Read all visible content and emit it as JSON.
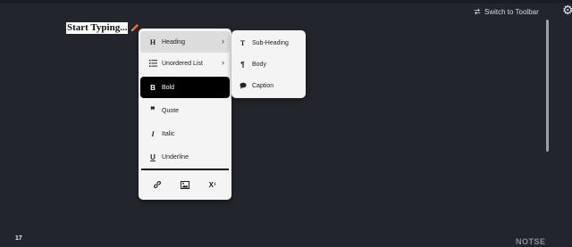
{
  "header": {
    "switch_toolbar_label": "Switch to Toolbar"
  },
  "editor": {
    "title": "Start Typing..."
  },
  "menu": {
    "items": [
      {
        "label": "Heading",
        "icon": "H",
        "has_submenu": true
      },
      {
        "label": "Unordered List",
        "icon": "list",
        "has_submenu": true
      },
      {
        "label": "Bold",
        "icon": "B"
      },
      {
        "label": "Quote",
        "icon": "quote"
      },
      {
        "label": "Italic",
        "icon": "I"
      },
      {
        "label": "Underline",
        "icon": "U"
      }
    ],
    "bottom_icons": [
      "link-icon",
      "image-icon",
      "superscript-icon"
    ],
    "superscript_glyph": "X¹"
  },
  "submenu": {
    "items": [
      {
        "label": "Sub-Heading",
        "icon": "T"
      },
      {
        "label": "Body",
        "icon": "paragraph"
      },
      {
        "label": "Caption",
        "icon": "speech-bubble"
      }
    ]
  },
  "footer": {
    "count": "17",
    "brand": "NOTSE"
  },
  "colors": {
    "background": "#23252d",
    "menu_bg": "#f4f4f4",
    "active_item": "#000000",
    "pencil": "#e8643c"
  }
}
